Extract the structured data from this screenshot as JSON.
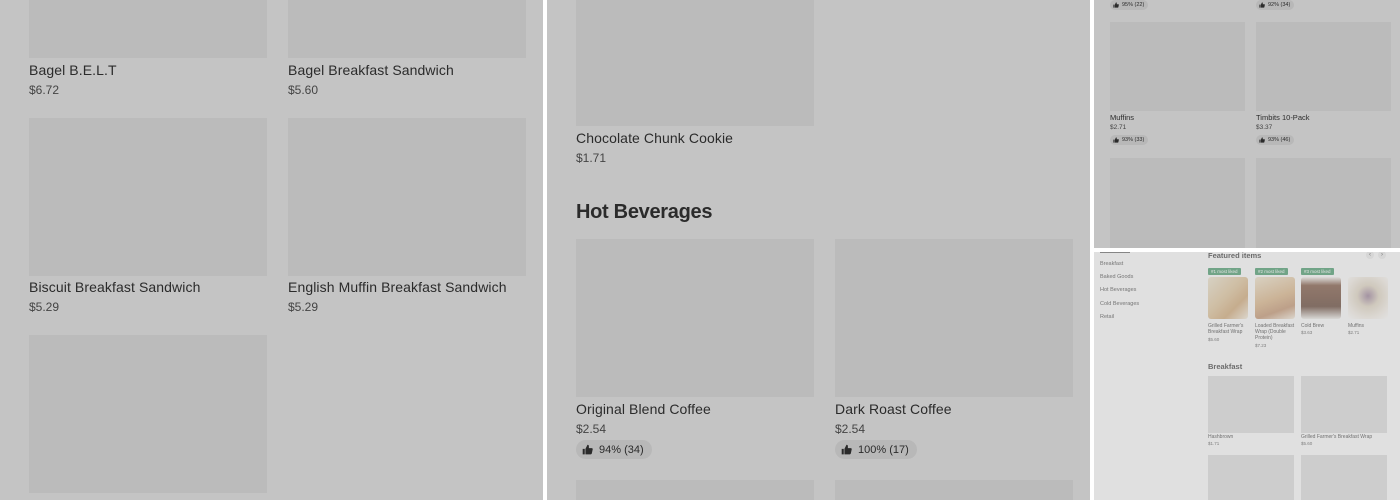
{
  "panel_a": {
    "items": [
      {
        "name": "Bagel B.E.L.T",
        "price": "$6.72"
      },
      {
        "name": "Bagel Breakfast Sandwich",
        "price": "$5.60"
      },
      {
        "name": "Biscuit Breakfast Sandwich",
        "price": "$5.29"
      },
      {
        "name": "English Muffin Breakfast Sandwich",
        "price": "$5.29"
      }
    ]
  },
  "panel_b": {
    "cookie": {
      "name": "Chocolate Chunk Cookie",
      "price": "$1.71"
    },
    "section_title": "Hot Beverages",
    "items": [
      {
        "name": "Original Blend Coffee",
        "price": "$2.54",
        "rating": "94% (34)"
      },
      {
        "name": "Dark Roast Coffee",
        "price": "$2.54",
        "rating": "100% (17)"
      }
    ]
  },
  "panel_c": {
    "top_ratings": [
      "95% (22)",
      "92% (34)"
    ],
    "items": [
      {
        "name": "Muffins",
        "price": "$2.71",
        "rating": "93% (33)"
      },
      {
        "name": "Timbits 10-Pack",
        "price": "$3.37",
        "rating": "93% (46)"
      }
    ]
  },
  "panel_d": {
    "sidebar": [
      "Breakfast",
      "Baked Goods",
      "Hot Beverages",
      "Cold Beverages",
      "Retail"
    ],
    "featured_title": "Featured items",
    "prev_icon": "‹",
    "next_icon": "›",
    "featured": [
      {
        "badge": "#1 most liked",
        "name": "Grilled Farmer's Breakfast Wrap",
        "price": "$5.60"
      },
      {
        "badge": "#2 most liked",
        "name": "Loaded Breakfast Wrap (Double Protein)",
        "price": "$7.23"
      },
      {
        "badge": "#3 most liked",
        "name": "Cold Brew",
        "price": "$3.63"
      },
      {
        "name": "Muffins",
        "price": "$2.71"
      }
    ],
    "breakfast_title": "Breakfast",
    "breakfast": [
      {
        "name": "Hashbrown",
        "price": "$1.71"
      },
      {
        "name": "Grilled Farmer's Breakfast Wrap",
        "price": "$5.60"
      }
    ]
  },
  "colors": {
    "overlay": "#c4c4c4",
    "tile": "#bbbbbb",
    "badge": "#2e8b57"
  }
}
